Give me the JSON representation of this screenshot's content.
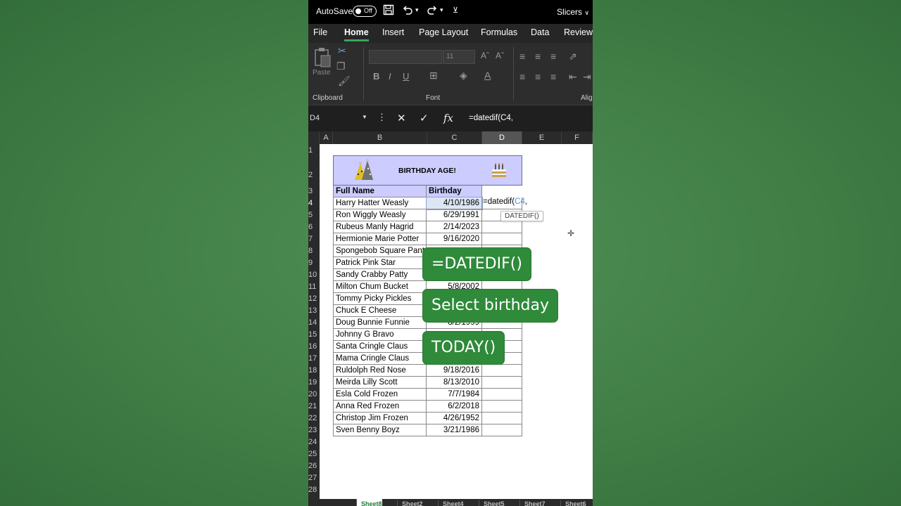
{
  "titlebar": {
    "autosave_label": "AutoSave",
    "autosave_state": "Off",
    "slicers_label": "Slicers"
  },
  "menu": {
    "tabs": [
      "File",
      "Home",
      "Insert",
      "Page Layout",
      "Formulas",
      "Data",
      "Review"
    ],
    "active": "Home"
  },
  "ribbon": {
    "paste_label": "Paste",
    "font_size": "11",
    "clipboard_label": "Clipboard",
    "font_label": "Font",
    "alignment_label": "Alig"
  },
  "formula_bar": {
    "name_box": "D4",
    "formula": "=datedif(C4,"
  },
  "columns": [
    "A",
    "B",
    "C",
    "D",
    "E",
    "F"
  ],
  "selected_column": "D",
  "rows": [
    "1",
    "2",
    "3",
    "4",
    "5",
    "6",
    "7",
    "8",
    "9",
    "10",
    "11",
    "12",
    "13",
    "14",
    "15",
    "16",
    "17",
    "18",
    "19",
    "20",
    "21",
    "22",
    "23",
    "24",
    "25",
    "26",
    "27",
    "28"
  ],
  "selected_row": "4",
  "sheet": {
    "title": "BIRTHDAY AGE!",
    "header_name": "Full Name",
    "header_birthday": "Birthday",
    "people": [
      {
        "name": "Harry Hatter Weasly",
        "birthday": "4/10/1986"
      },
      {
        "name": "Ron Wiggly Weasly",
        "birthday": "6/29/1991"
      },
      {
        "name": "Rubeus Manly Hagrid",
        "birthday": "2/14/2023"
      },
      {
        "name": "Hermionie Marie Potter",
        "birthday": "9/16/2020"
      },
      {
        "name": "Spongebob Square Pant",
        "birthday": ""
      },
      {
        "name": "Patrick Pink Star",
        "birthday": ""
      },
      {
        "name": "Sandy Crabby Patty",
        "birthday": ""
      },
      {
        "name": "Milton Chum Bucket",
        "birthday": "5/8/2002"
      },
      {
        "name": "Tommy Picky Pickles",
        "birthday": ""
      },
      {
        "name": "Chuck E Cheese",
        "birthday": ""
      },
      {
        "name": "Doug Bunnie Funnie",
        "birthday": "8/2/1999"
      },
      {
        "name": "Johnny G Bravo",
        "birthday": ""
      },
      {
        "name": "Santa Cringle Claus",
        "birthday": ""
      },
      {
        "name": "Mama Cringle Claus",
        "birthday": ""
      },
      {
        "name": "Ruldolph Red Nose",
        "birthday": "9/18/2016"
      },
      {
        "name": "Meirda Lilly Scott",
        "birthday": "8/13/2010"
      },
      {
        "name": "Esla Cold Frozen",
        "birthday": "7/7/1984"
      },
      {
        "name": "Anna Red Frozen",
        "birthday": "6/2/2018"
      },
      {
        "name": "Christop Jim Frozen",
        "birthday": "4/26/1952"
      },
      {
        "name": "Sven Benny Boyz",
        "birthday": "3/21/1986"
      }
    ],
    "edit_prefix": "=datedif(",
    "edit_ref": "C4",
    "edit_suffix": ",",
    "tooltip": "DATEDIF()"
  },
  "overlays": {
    "step1": "=DATEDIF()",
    "step2": "Select birthday",
    "step3": "TODAY()"
  },
  "sheet_tabs": [
    "Sheet8",
    "Sheet2",
    "Sheet4",
    "Sheet5",
    "Sheet7",
    "Sheet6"
  ],
  "colors": {
    "accent": "#3da35d",
    "title_fill": "#ccccff",
    "overlay_green": "#2f8a3a"
  }
}
